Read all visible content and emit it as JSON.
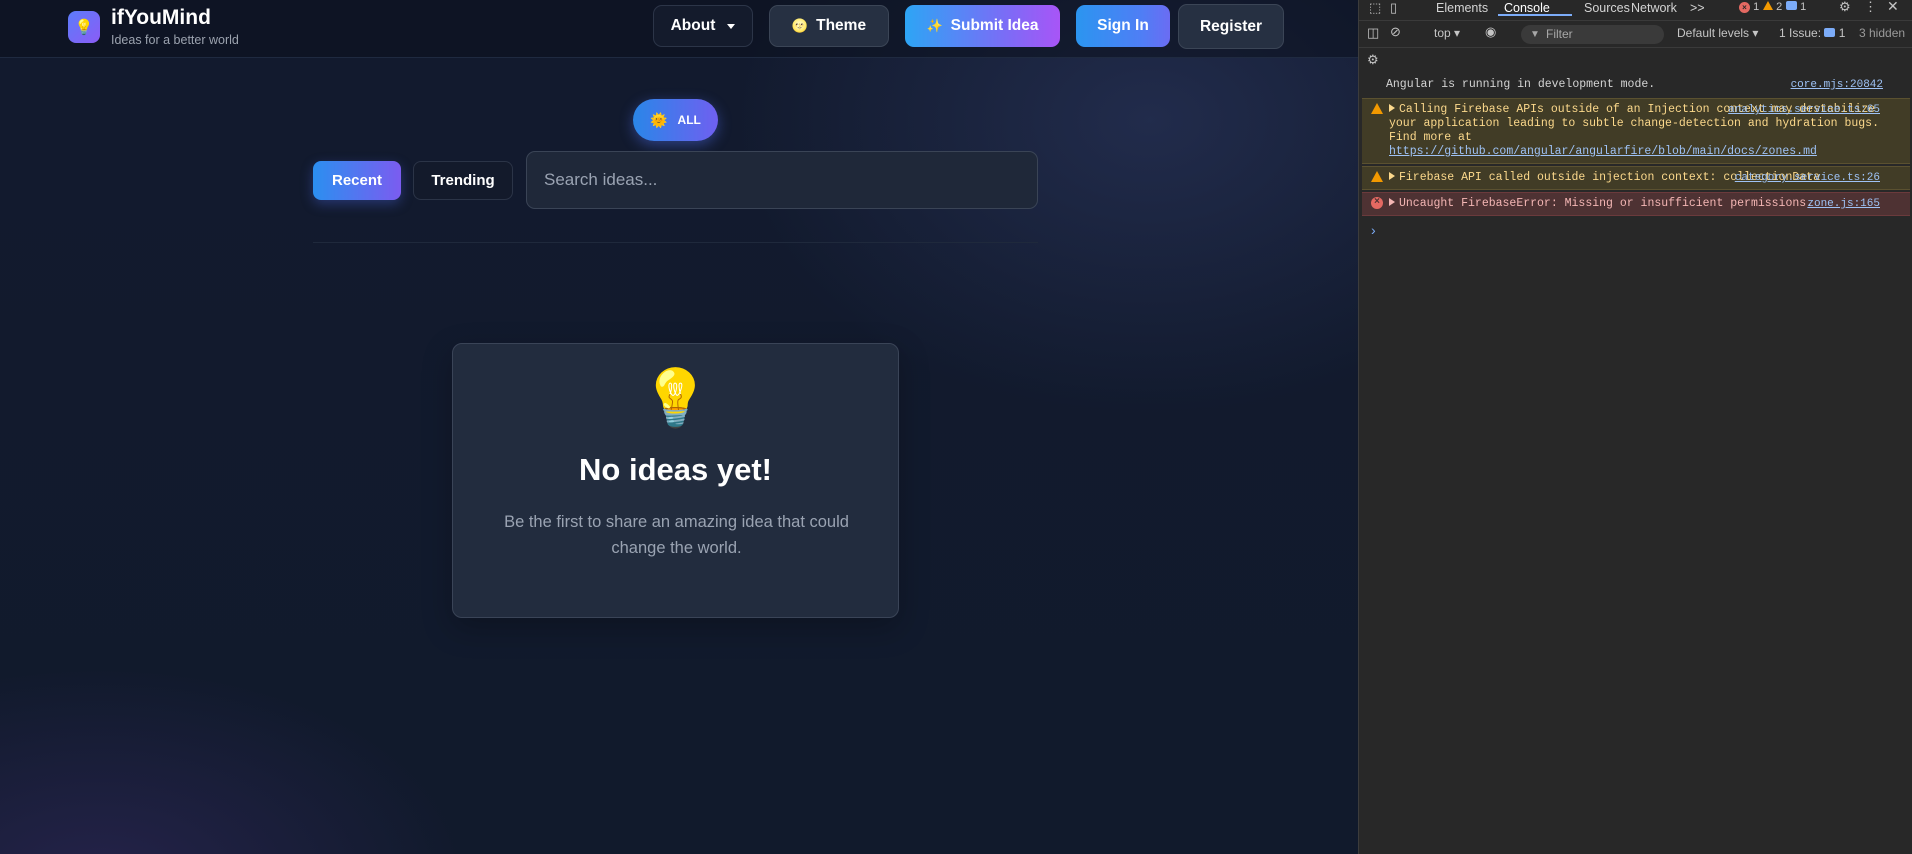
{
  "app": {
    "brand": {
      "title": "ifYouMind",
      "subtitle": "Ideas for a better world",
      "logo_icon": "💡"
    },
    "header": {
      "about_label": "About",
      "theme_icon": "🌝",
      "theme_label": "Theme",
      "submit_icon": "✨",
      "submit_label": "Submit Idea",
      "signin_label": "Sign In",
      "register_label": "Register"
    },
    "category_pill": {
      "icon": "🌞",
      "label": "ALL"
    },
    "filters": {
      "recent_label": "Recent",
      "trending_label": "Trending"
    },
    "search": {
      "placeholder": "Search ideas..."
    },
    "empty_state": {
      "icon": "💡",
      "title": "No ideas yet!",
      "description": "Be the first to share an amazing idea that could change the world."
    }
  },
  "devtools": {
    "tabs": [
      "Elements",
      "Console",
      "Sources",
      "Network"
    ],
    "more_tabs": ">>",
    "counts": {
      "errors": "1",
      "warnings": "2",
      "info": "1"
    },
    "toolbar": {
      "context": "top",
      "filter_placeholder": "Filter",
      "levels": "Default levels",
      "issues_label": "1 Issue:",
      "issues_count": "1",
      "hidden": "3 hidden"
    },
    "messages": [
      {
        "level": "info",
        "text": "Angular is running in development mode.",
        "source": "core.mjs:20842"
      },
      {
        "level": "warning",
        "text": "Calling Firebase APIs outside of an Injection context may destabilize your application leading to subtle change-detection and hydration bugs. Find more at",
        "link": "https://github.com/angular/angularfire/blob/main/docs/zones.md",
        "source": "analytics.service.ts:65"
      },
      {
        "level": "warning",
        "text": "Firebase API called outside injection context: collectionData",
        "source": "category.service.ts:26"
      },
      {
        "level": "error",
        "text": "Uncaught FirebaseError: Missing or insufficient permissions.",
        "source": "zone.js:165"
      }
    ],
    "prompt_symbol": "›"
  },
  "colors": {
    "accent_gradient_start": "#2da5f5",
    "accent_gradient_end": "#a855f7",
    "background": "#111a2c",
    "devtools_bg": "#282828"
  }
}
